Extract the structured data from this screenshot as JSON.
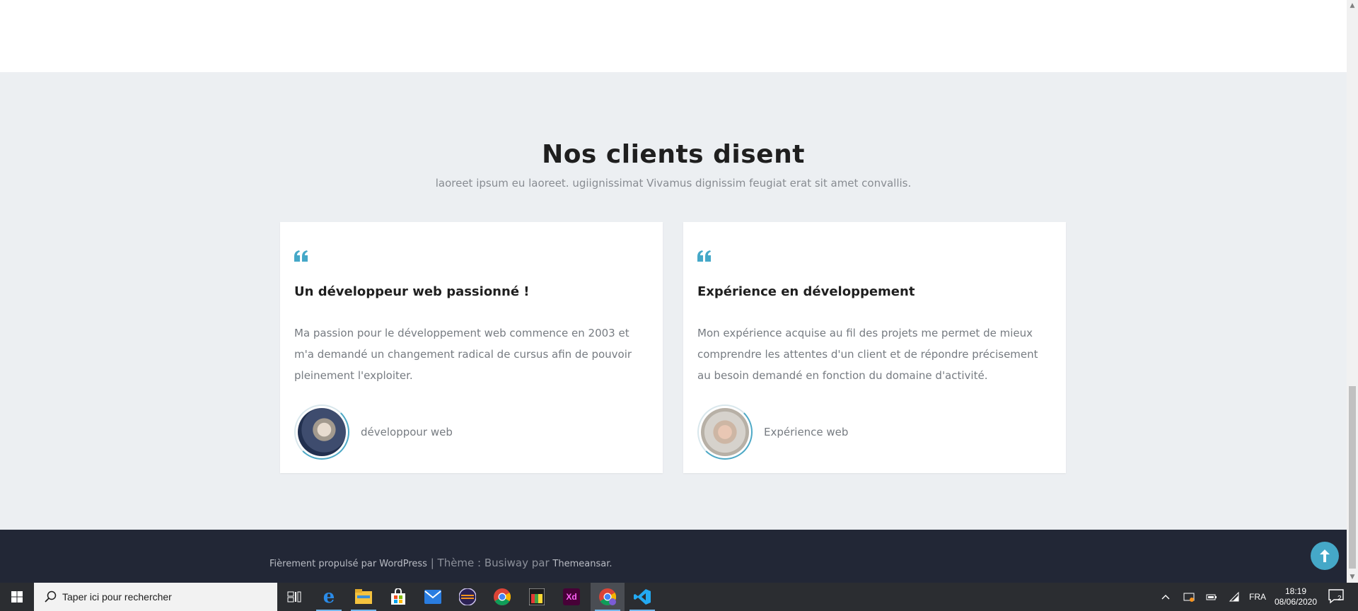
{
  "section": {
    "title": "Nos clients disent",
    "subtitle": "laoreet ipsum eu laoreet. ugiignissimat Vivamus dignissim feugiat erat sit amet convallis."
  },
  "testimonials": [
    {
      "title": "Un développeur web passionné !",
      "text": "Ma passion pour le développement web commence en 2003 et m'a demandé un changement radical de cursus afin de pouvoir pleinement l'exploiter.",
      "author": "développour web"
    },
    {
      "title": "Expérience en développement",
      "text": "Mon expérience acquise au fil des projets me permet de mieux comprendre les attentes d'un client et de répondre précisement au besoin demandé en fonction du domaine d'activité.",
      "author": "Expérience web"
    }
  ],
  "footer": {
    "powered": "Fièrement propulsé par WordPress",
    "separator": " | ",
    "theme_label": "Thème : Busiway par ",
    "theme_author": "Themeansar",
    "period": "."
  },
  "back_to_top": {
    "icon": "arrow-up-icon",
    "glyph": "🠙"
  },
  "taskbar": {
    "search_placeholder": "Taper ici pour rechercher",
    "apps": [
      {
        "name": "task-view-icon",
        "label": "",
        "color": "#2b2d31"
      },
      {
        "name": "edge-icon",
        "label": "e",
        "color": "#1e7ad7"
      },
      {
        "name": "file-explorer-icon",
        "label": "",
        "color": "#f4c23f"
      },
      {
        "name": "store-icon",
        "label": "",
        "color": "#2b2d31"
      },
      {
        "name": "mail-icon",
        "label": "",
        "color": "#2a7de1"
      },
      {
        "name": "eclipse-icon",
        "label": "",
        "color": "#2c2255"
      },
      {
        "name": "chrome-icon",
        "label": "",
        "color": "#2b2d31"
      },
      {
        "name": "colorpicker-icon",
        "label": "",
        "color": "#2b2d31"
      },
      {
        "name": "adobe-xd-icon",
        "label": "Xd",
        "color": "#470137"
      },
      {
        "name": "chrome-profile-icon",
        "label": "",
        "color": "#2b2d31"
      },
      {
        "name": "vscode-icon",
        "label": "",
        "color": "#2b2d31"
      }
    ],
    "language": "FRA",
    "time": "18:19",
    "date": "08/06/2020",
    "notification_count": "2"
  },
  "colors": {
    "accent": "#45a8c8",
    "footer_bg": "#222736",
    "section_bg": "#eceff2"
  }
}
